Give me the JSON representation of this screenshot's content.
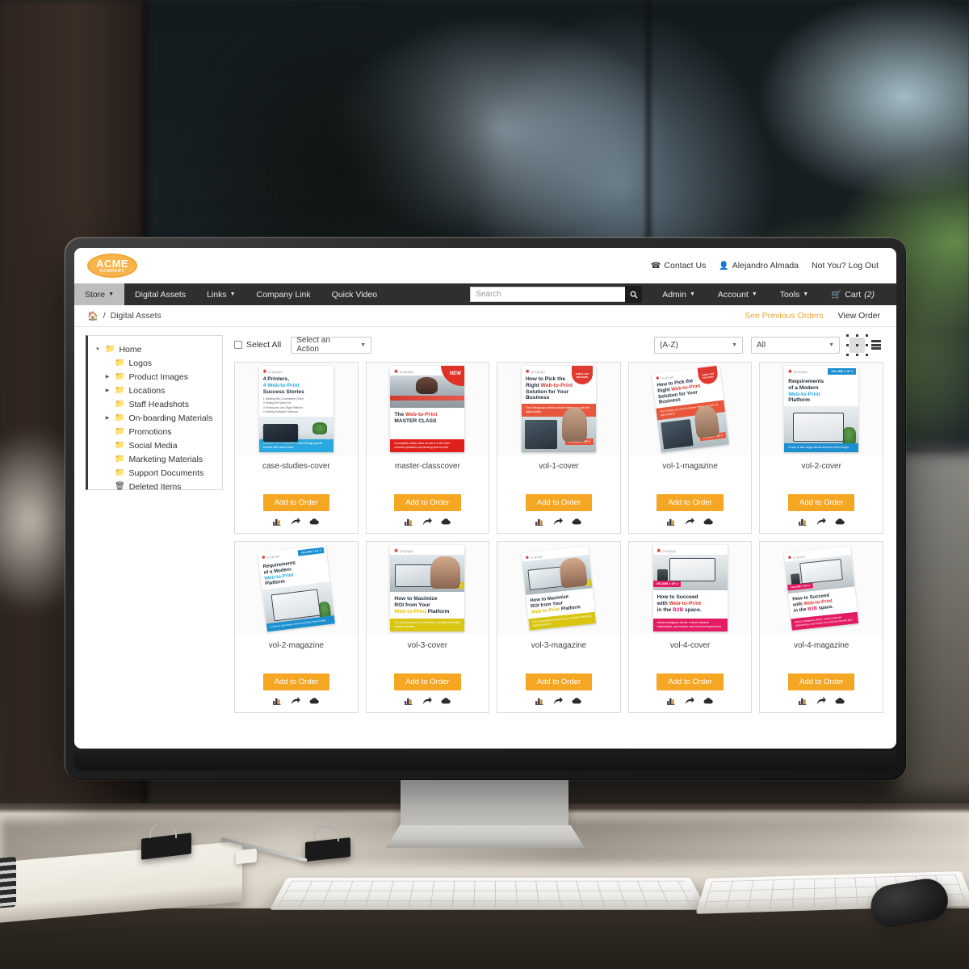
{
  "brand": {
    "name": "ACME",
    "sub": "COMPANY"
  },
  "utility": {
    "contact": "Contact Us",
    "user": "Alejandro Almada",
    "logout": "Not You? Log Out",
    "phone_icon": "phone-icon",
    "user_icon": "user-icon"
  },
  "nav": {
    "left": [
      {
        "label": "Store",
        "caret": true,
        "active": true
      },
      {
        "label": "Digital Assets",
        "caret": false,
        "active": false
      },
      {
        "label": "Links",
        "caret": true,
        "active": false
      },
      {
        "label": "Company Link",
        "caret": false,
        "active": false
      },
      {
        "label": "Quick Video",
        "caret": false,
        "active": false
      }
    ],
    "right": [
      {
        "label": "Admin",
        "caret": true
      },
      {
        "label": "Account",
        "caret": true
      },
      {
        "label": "Tools",
        "caret": true
      }
    ],
    "cart": {
      "label": "Cart",
      "count": "(2)",
      "icon": "cart-icon"
    }
  },
  "search": {
    "placeholder": "Search",
    "value": "",
    "icon": "search-icon"
  },
  "breadcrumb": {
    "home_icon": "home-icon",
    "separator": "/",
    "current": "Digital Assets",
    "previous_orders": "See Previous Orders",
    "view_order": "View Order"
  },
  "sidebar": {
    "items": [
      {
        "label": "Home",
        "level": 0,
        "arrow": "down",
        "icon": "folder-icon"
      },
      {
        "label": "Logos",
        "level": 1,
        "arrow": "none",
        "icon": "folder-icon"
      },
      {
        "label": "Product Images",
        "level": 1,
        "arrow": "right",
        "icon": "folder-icon"
      },
      {
        "label": "Locations",
        "level": 1,
        "arrow": "right",
        "icon": "folder-icon"
      },
      {
        "label": "Staff Headshots",
        "level": 1,
        "arrow": "none",
        "icon": "folder-icon"
      },
      {
        "label": "On-boarding Materials",
        "level": 1,
        "arrow": "right",
        "icon": "folder-icon"
      },
      {
        "label": "Promotions",
        "level": 1,
        "arrow": "none",
        "icon": "folder-icon"
      },
      {
        "label": "Social Media",
        "level": 1,
        "arrow": "none",
        "icon": "folder-icon"
      },
      {
        "label": "Marketing Materials",
        "level": 1,
        "arrow": "none",
        "icon": "folder-icon"
      },
      {
        "label": "Support Documents",
        "level": 1,
        "arrow": "none",
        "icon": "folder-icon"
      },
      {
        "label": "Deleted Items",
        "level": 1,
        "arrow": "none",
        "icon": "trash-icon"
      }
    ]
  },
  "toolbar": {
    "select_all": "Select All",
    "action_select": "Select an Action",
    "sort_select": "(A-Z)",
    "filter_select": "All",
    "grid_view_icon": "grid-view-icon",
    "list_view_icon": "list-view-icon",
    "active_view": "grid"
  },
  "card_actions": {
    "add_to_order": "Add to Order",
    "icons": [
      "chart-bar-icon",
      "share-arrow-icon",
      "cloud-download-icon"
    ]
  },
  "assets": [
    {
      "name": "case-studies-cover",
      "art": {
        "kind": "cover",
        "brand": "propago",
        "title_lines": [
          {
            "text": "4 Printers,",
            "color": "dark"
          },
          {
            "text": "4 Web-to-Print",
            "color": "blue"
          },
          {
            "text": "Success Stories",
            "color": "dark"
          }
        ],
        "bullets": [
          "1 Winning the Cornerstone Client",
          "2 Ending the Sales Rut",
          "3 Finding the Just-Right Platform",
          "4 Solving Software Overload"
        ],
        "photo": "desk-laptop",
        "band_text": "Discover how 4 companies broke through growth barriers with web-to-print.",
        "band_color": "#2aa9e0",
        "badge": null
      }
    },
    {
      "name": "master-classcover",
      "art": {
        "kind": "cover-photo-top",
        "brand": "propago",
        "title_lines": [
          {
            "text": "The Web-to-Print",
            "color": "mixed-red"
          },
          {
            "text": "MASTER CLASS",
            "color": "dark"
          }
        ],
        "photo": "print-shop-man",
        "band_text": "A complete master class on some of the most common questions surrounding web-to-print.",
        "band_color": "#e0201b",
        "badge": {
          "type": "ribbon",
          "text": "NEW",
          "color": "#e03127"
        }
      }
    },
    {
      "name": "vol-1-cover",
      "art": {
        "kind": "cover",
        "brand": "propago",
        "title_lines": [
          {
            "text": "How to Pick the",
            "color": "dark"
          },
          {
            "text": "Right Web-to-Print",
            "color": "mixed-red"
          },
          {
            "text": "Solution for Your",
            "color": "dark"
          },
          {
            "text": "Business",
            "color": "dark"
          }
        ],
        "photo": "two-women-screen",
        "band_text": "The 5 things you need to answer before you pick the right solution.",
        "band_color": "#e8573c",
        "badge": {
          "type": "check",
          "text": "CHECK LIST INCLUDED",
          "color": "#e0392f"
        },
        "volume": "VOLUME 1 OF 4"
      }
    },
    {
      "name": "vol-1-magazine",
      "art": {
        "kind": "magazine",
        "brand": "propago",
        "title_lines": [
          {
            "text": "How to Pick the",
            "color": "dark"
          },
          {
            "text": "Right Web-to-Print",
            "color": "mixed-red"
          },
          {
            "text": "Solution for Your",
            "color": "dark"
          },
          {
            "text": "Business",
            "color": "dark"
          }
        ],
        "photo": "two-women-screen",
        "band_text": "The 5 things you need to answer before you pick the right solution.",
        "band_color": "#e8573c",
        "badge": {
          "type": "check",
          "text": "CHECK LIST INCLUDED",
          "color": "#e0392f"
        },
        "volume": "VOLUME 1 OF 4"
      }
    },
    {
      "name": "vol-2-cover",
      "art": {
        "kind": "cover",
        "brand": "propago",
        "title_lines": [
          {
            "text": "Requirements",
            "color": "dark"
          },
          {
            "text": "of a Modern",
            "color": "dark"
          },
          {
            "text": "Web-to-Print",
            "color": "blue"
          },
          {
            "text": "Platform",
            "color": "dark"
          }
        ],
        "photo": "woman-tablet",
        "band_text": "5 keys to land larger clients and keep them longer.",
        "band_color": "#1b8fd0",
        "badge": {
          "type": "tag",
          "text": "VOLUME 2 OF 4",
          "color": "#1b8fd0"
        },
        "volume": "VOLUME 2 OF 4"
      }
    },
    {
      "name": "vol-2-magazine",
      "art": {
        "kind": "magazine",
        "brand": "propago",
        "title_lines": [
          {
            "text": "Requirements",
            "color": "dark"
          },
          {
            "text": "of a Modern",
            "color": "dark"
          },
          {
            "text": "Web-to-Print",
            "color": "blue"
          },
          {
            "text": "Platform",
            "color": "dark"
          }
        ],
        "photo": "woman-tablet",
        "band_text": "5 keys to land larger clients and keep them longer.",
        "band_color": "#1b8fd0",
        "badge": {
          "type": "tag",
          "text": "VOLUME 2 OF 4",
          "color": "#1b8fd0"
        },
        "volume": "VOLUME 2 OF 4"
      }
    },
    {
      "name": "vol-3-cover",
      "art": {
        "kind": "cover-photo-top",
        "brand": "propago",
        "title_lines": [
          {
            "text": "How to Maximize",
            "color": "dark"
          },
          {
            "text": "ROI from Your",
            "color": "dark"
          },
          {
            "text": "Web-to-Print Platform",
            "color": "mixed-yellow"
          }
        ],
        "photo": "man-laptop-smiling",
        "band_text": "The 4-step process to becoming a complete marketing solution provider.",
        "band_color": "#d8c613",
        "badge": {
          "type": "tag",
          "text": "VOLUME 3 OF 4",
          "color": "#d8c613"
        },
        "volume": "VOLUME 3 OF 4"
      }
    },
    {
      "name": "vol-3-magazine",
      "art": {
        "kind": "magazine",
        "brand": "propago",
        "title_lines": [
          {
            "text": "How to Maximize",
            "color": "dark"
          },
          {
            "text": "ROI from Your",
            "color": "dark"
          },
          {
            "text": "Web-to-Print Platform",
            "color": "mixed-yellow"
          }
        ],
        "photo": "man-laptop-smiling",
        "band_text": "The 4-step process to becoming a complete marketing solution provider.",
        "band_color": "#d8c613",
        "badge": {
          "type": "tag",
          "text": "VOLUME 3 OF 4",
          "color": "#d8c613"
        },
        "volume": "VOLUME 3 OF 4"
      }
    },
    {
      "name": "vol-4-cover",
      "art": {
        "kind": "cover-photo-top",
        "brand": "propago",
        "title_lines": [
          {
            "text": "How to Succeed",
            "color": "dark"
          },
          {
            "text": "with Web-to-Print",
            "color": "mixed-red"
          },
          {
            "text": "in the B2B space.",
            "color": "mixed-pink"
          }
        ],
        "photo": "office-monitor",
        "band_text": "Attract prestigious clients, extend customer relationships, and explore new horizons beyond print.",
        "band_color": "#e31b62",
        "badge": {
          "type": "tag",
          "text": "VOLUME 4 OF 4",
          "color": "#e31b62"
        },
        "volume": "VOLUME 4 OF 4"
      }
    },
    {
      "name": "vol-4-magazine",
      "art": {
        "kind": "magazine",
        "brand": "propago",
        "title_lines": [
          {
            "text": "How to Succeed",
            "color": "dark"
          },
          {
            "text": "with Web-to-Print",
            "color": "mixed-red"
          },
          {
            "text": "in the B2B space.",
            "color": "mixed-pink"
          }
        ],
        "photo": "office-monitor",
        "band_text": "Attract prestigious clients, extend customer relationships, and explore new horizons beyond print.",
        "band_color": "#e31b62",
        "badge": {
          "type": "tag",
          "text": "VOLUME 4 OF 4",
          "color": "#e31b62"
        },
        "volume": "VOLUME 4 OF 4"
      }
    }
  ],
  "colors": {
    "accent": "#f5a623",
    "nav_bg": "#2f2f2f",
    "link": "#f0a330"
  }
}
